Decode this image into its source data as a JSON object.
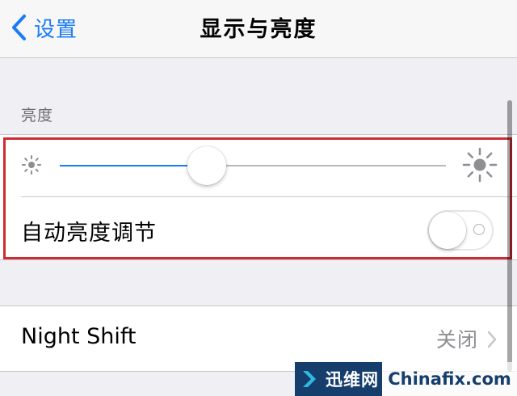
{
  "nav": {
    "back_label": "设置",
    "title": "显示与亮度"
  },
  "brightness": {
    "section_header": "亮度",
    "level": 0.38,
    "auto_label": "自动亮度调节",
    "auto_enabled": false
  },
  "night_shift": {
    "label": "Night Shift",
    "value": "关闭"
  },
  "icons": [
    "chevron-left-icon",
    "sun-small-icon",
    "sun-large-icon",
    "chevron-right-icon"
  ],
  "colors": {
    "accent": "#1a7cf5",
    "highlight": "#d02a33",
    "background": "#efeff4"
  },
  "watermark": {
    "brand": "迅维网",
    "domain": "Chinafix.com"
  }
}
